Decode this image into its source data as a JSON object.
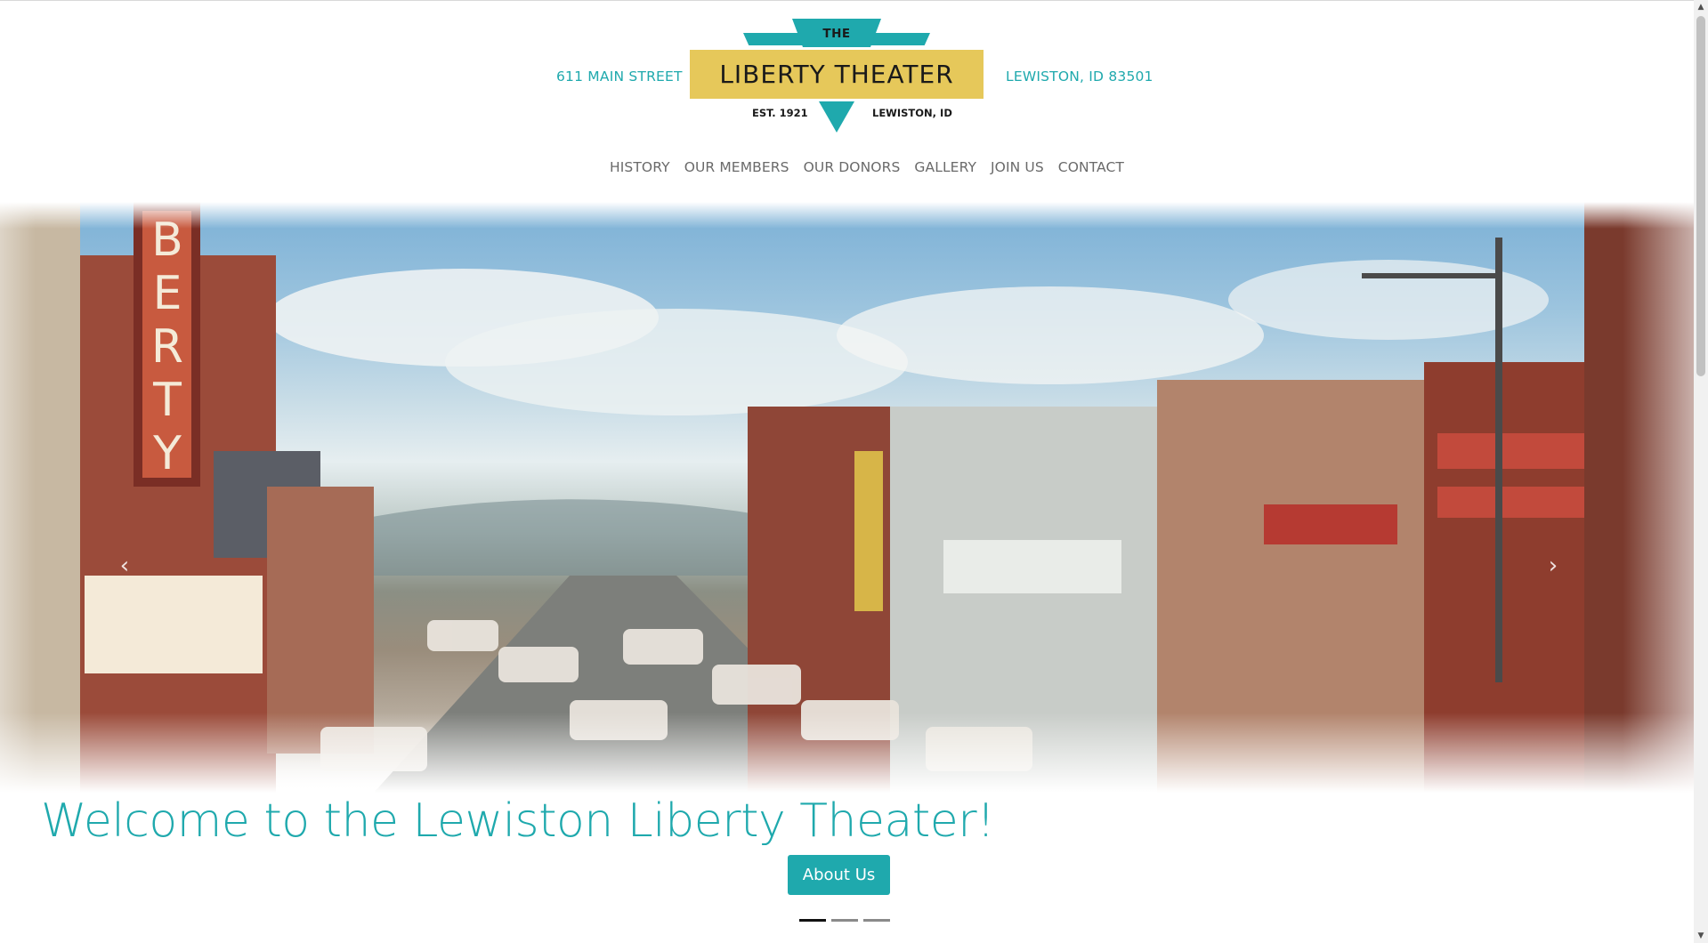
{
  "header": {
    "address_left": "611 MAIN STREET",
    "address_right": "LEWISTON, ID 83501",
    "logo": {
      "top_text": "THE",
      "main_text": "LIBERTY THEATER",
      "est_text": "EST. 1921",
      "location_text": "LEWISTON, ID",
      "colors": {
        "teal": "#1fa9ad",
        "gold": "#e6c85a"
      }
    }
  },
  "nav": {
    "items": [
      {
        "label": "HISTORY"
      },
      {
        "label": "OUR MEMBERS"
      },
      {
        "label": "OUR DONORS"
      },
      {
        "label": "GALLERY"
      },
      {
        "label": "JOIN US"
      },
      {
        "label": "CONTACT"
      }
    ]
  },
  "carousel": {
    "image": "vintage-main-street-postcard",
    "sign_letters": "BERTY",
    "prev_icon": "chevron-left-icon",
    "next_icon": "chevron-right-icon",
    "indicators": {
      "count": 3,
      "active": 1
    }
  },
  "hero": {
    "headline": "Welcome to the Lewiston Liberty Theater!",
    "cta_label": "About Us"
  },
  "colors": {
    "accent": "#1fa9ad",
    "nav_text": "#6a6a6a"
  }
}
